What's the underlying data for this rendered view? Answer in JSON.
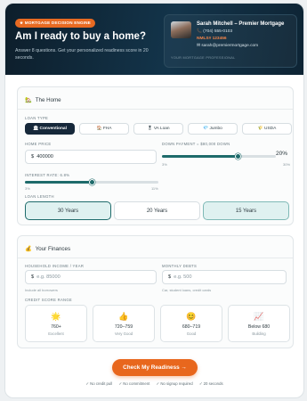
{
  "header": {
    "badge": "★ MORTGAGE DECISION ENGINE",
    "title": "Am I ready to buy a home?",
    "subtitle": "Answer 8 questions. Get your personalized readiness score in 20 seconds."
  },
  "agent": {
    "name": "Sarah Mitchell – Premier Mortgage",
    "phone": "📞 (704) 555-0103",
    "nmls": "NMLS# 123456",
    "email": "✉ sarah@premiermortgage.com",
    "footer": "YOUR MORTGAGE PROFESSIONAL"
  },
  "home": {
    "heading": "The Home",
    "icon": "🏡",
    "loan_type_label": "LOAN TYPE",
    "loan_types": [
      {
        "label": "🏛 Conventional",
        "active": true
      },
      {
        "label": "🏠 FHA",
        "active": false
      },
      {
        "label": "🎖 VA Loan",
        "active": false
      },
      {
        "label": "💎 Jumbo",
        "active": false
      },
      {
        "label": "🌾 USDA",
        "active": false
      }
    ],
    "home_price_label": "HOME PRICE",
    "home_price_prefix": "$",
    "home_price_value": "400000",
    "down_payment_label": "DOWN PAYMENT = $80,000 DOWN",
    "down_payment_value": "20%",
    "down_payment_fraction": 0.667,
    "down_min": "3%",
    "down_max": "30%",
    "interest_label": "INTEREST RATE: 6.8%",
    "interest_fraction": 0.5,
    "interest_min": "3%",
    "interest_max": "11%",
    "loan_length_label": "LOAN LENGTH",
    "terms": [
      {
        "label": "30 Years",
        "state": "active"
      },
      {
        "label": "20 Years",
        "state": "none"
      },
      {
        "label": "15 Years",
        "state": "selected"
      }
    ]
  },
  "finances": {
    "heading": "Your Finances",
    "icon": "💰",
    "income_label": "HOUSEHOLD INCOME / YEAR",
    "income_prefix": "$",
    "income_placeholder": "e.g. 85000",
    "income_hint": "Include all borrowers",
    "debts_label": "MONTHLY DEBTS",
    "debts_prefix": "$",
    "debts_placeholder": "e.g. 500",
    "debts_hint": "Car, student loans, credit cards",
    "credit_label": "CREDIT SCORE RANGE",
    "credit_options": [
      {
        "icon": "🌟",
        "range": "760+",
        "desc": "Excellent"
      },
      {
        "icon": "👍",
        "range": "720–759",
        "desc": "Very Good"
      },
      {
        "icon": "😊",
        "range": "680–719",
        "desc": "Good"
      },
      {
        "icon": "📈",
        "range": "Below 680",
        "desc": "Building"
      }
    ]
  },
  "cta": {
    "label": "Check My Readiness →"
  },
  "assurances": [
    "✓ No credit pull",
    "✓ No commitment",
    "✓ No signup required",
    "✓ 20 seconds"
  ],
  "colors": {
    "accent": "#e8671d",
    "teal": "#1e6b6b",
    "navy": "#16283a"
  }
}
